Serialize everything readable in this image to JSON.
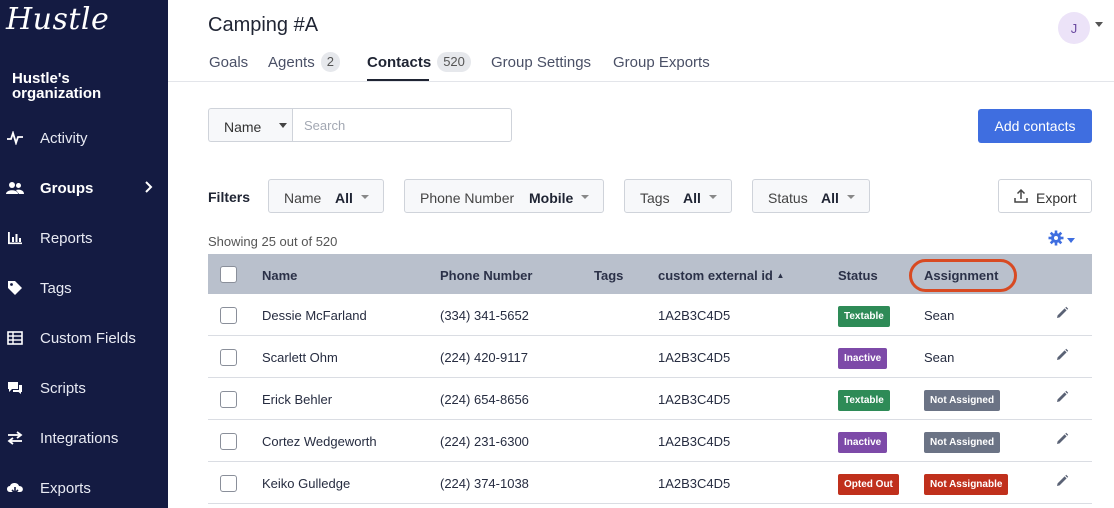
{
  "sidebar": {
    "logo": "Hustle",
    "org_name": "Hustle's organization",
    "items": [
      {
        "label": "Activity",
        "icon": "activity-icon"
      },
      {
        "label": "Groups",
        "icon": "groups-icon",
        "active": true
      },
      {
        "label": "Reports",
        "icon": "reports-icon"
      },
      {
        "label": "Tags",
        "icon": "tag-icon"
      },
      {
        "label": "Custom Fields",
        "icon": "custom-fields-icon"
      },
      {
        "label": "Scripts",
        "icon": "scripts-icon"
      },
      {
        "label": "Integrations",
        "icon": "integrations-icon"
      },
      {
        "label": "Exports",
        "icon": "exports-icon"
      }
    ]
  },
  "header": {
    "title": "Camping #A",
    "avatar_initial": "J"
  },
  "tabs": [
    {
      "label": "Goals"
    },
    {
      "label": "Agents",
      "badge": "2"
    },
    {
      "label": "Contacts",
      "badge": "520",
      "active": true
    },
    {
      "label": "Group Settings"
    },
    {
      "label": "Group Exports"
    }
  ],
  "search": {
    "field_select": "Name",
    "placeholder": "Search",
    "value": ""
  },
  "add_button": "Add contacts",
  "filters": {
    "label": "Filters",
    "items": [
      {
        "label": "Name",
        "value": "All"
      },
      {
        "label": "Phone Number",
        "value": "Mobile"
      },
      {
        "label": "Tags",
        "value": "All"
      },
      {
        "label": "Status",
        "value": "All"
      }
    ],
    "export_label": "Export"
  },
  "showing": "Showing 25 out of 520",
  "table": {
    "columns": [
      "Name",
      "Phone Number",
      "Tags",
      "custom external id",
      "Status",
      "Assignment"
    ],
    "sort_column": "custom external id",
    "sort_indicator": "▲",
    "rows": [
      {
        "name": "Dessie McFarland",
        "phone": "(334) 341-5652",
        "tags": "",
        "external_id": "1A2B3C4D5",
        "status": "Textable",
        "assignment": "Sean",
        "assignment_badge": false
      },
      {
        "name": "Scarlett Ohm",
        "phone": "(224) 420-9117",
        "tags": "",
        "external_id": "1A2B3C4D5",
        "status": "Inactive",
        "assignment": "Sean",
        "assignment_badge": false
      },
      {
        "name": "Erick Behler",
        "phone": "(224) 654-8656",
        "tags": "",
        "external_id": "1A2B3C4D5",
        "status": "Textable",
        "assignment": "Not Assigned",
        "assignment_badge": true
      },
      {
        "name": "Cortez Wedgeworth",
        "phone": "(224) 231-6300",
        "tags": "",
        "external_id": "1A2B3C4D5",
        "status": "Inactive",
        "assignment": "Not Assigned",
        "assignment_badge": true
      },
      {
        "name": "Keiko Gulledge",
        "phone": "(224) 374-1038",
        "tags": "",
        "external_id": "1A2B3C4D5",
        "status": "Opted Out",
        "assignment": "Not Assignable",
        "assignment_badge": true
      }
    ]
  },
  "colors": {
    "sidebar_bg": "#141b42",
    "primary": "#3f6ee0",
    "textable": "#2e8b57",
    "inactive": "#7d4aa8",
    "opted_out": "#c0301c",
    "not_assigned": "#6b7385",
    "not_assignable": "#c0301c",
    "highlight_circle": "#d84a22"
  }
}
